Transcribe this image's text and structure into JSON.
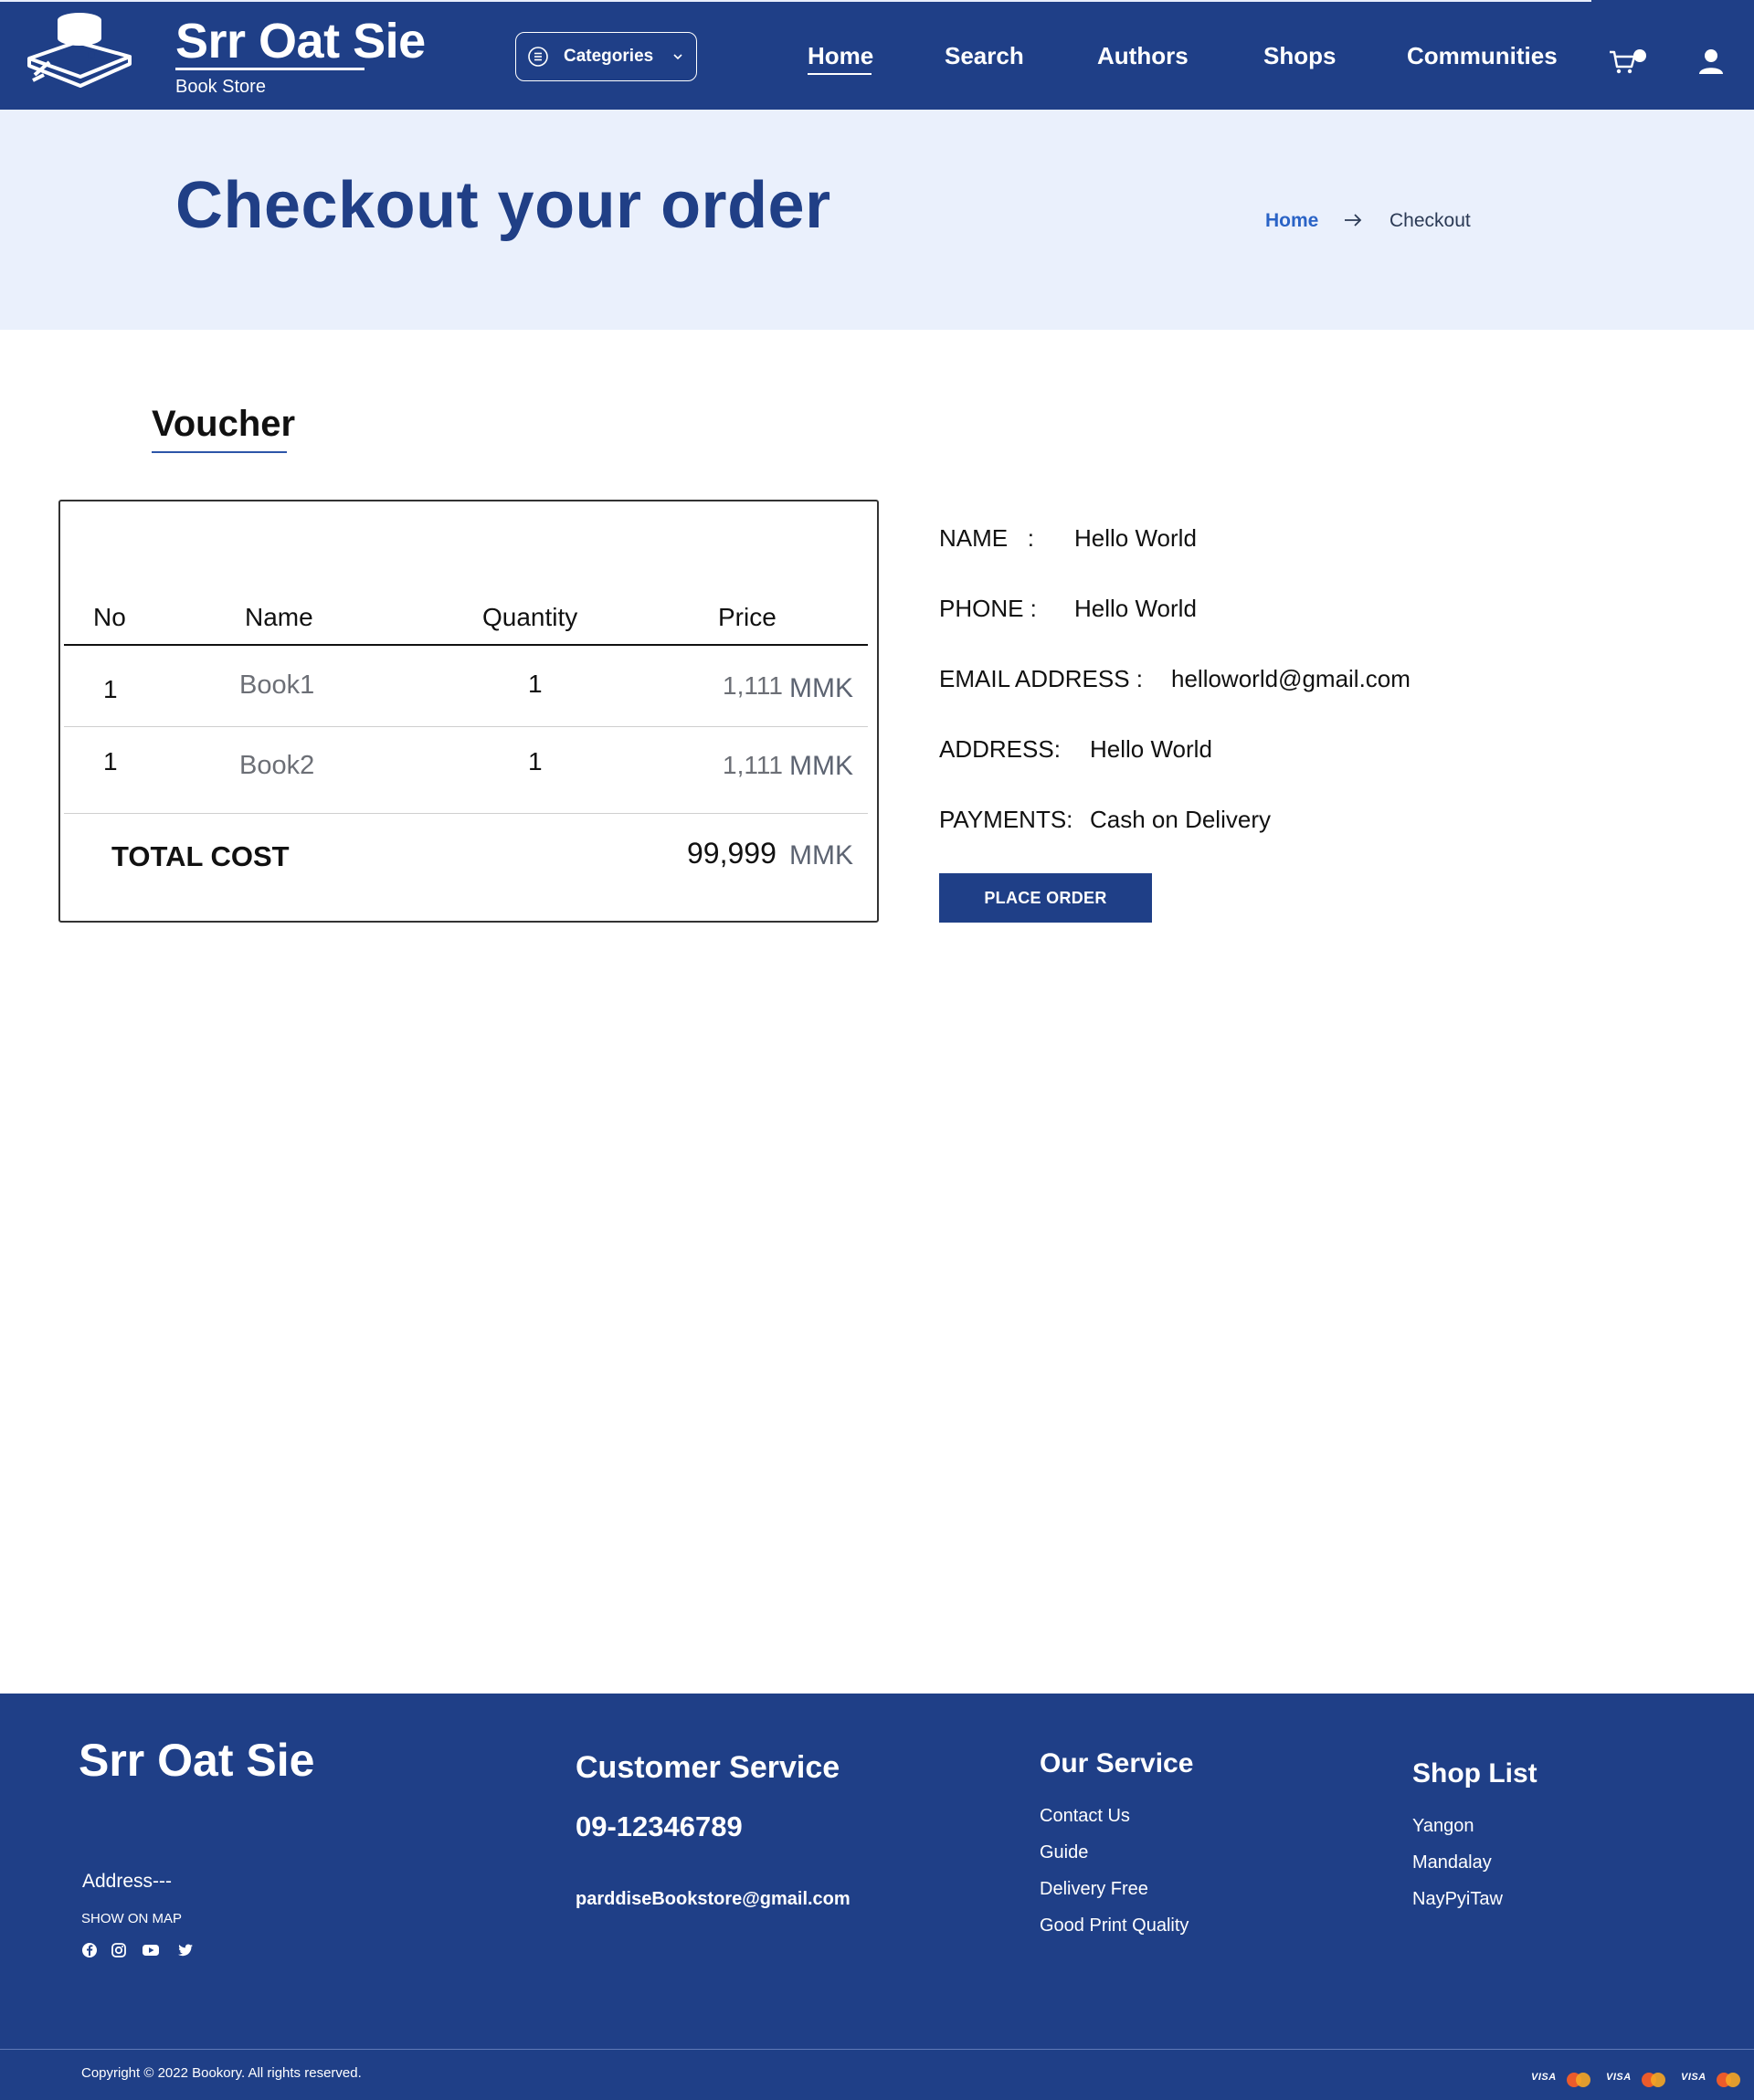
{
  "header": {
    "brand_name": "Srr Oat Sie",
    "brand_subtitle": "Book Store",
    "categories_label": "Categories",
    "nav": [
      "Home",
      "Search",
      "Authors",
      "Shops",
      "Communities"
    ],
    "icons": [
      "books-logo-icon",
      "list-icon",
      "chevron-down-icon",
      "cart-icon",
      "user-icon"
    ]
  },
  "banner": {
    "title": "Checkout your order",
    "breadcrumb_home": "Home",
    "breadcrumb_current": "Checkout"
  },
  "voucher": {
    "title": "Voucher",
    "columns": [
      "No",
      "Name",
      "Quantity",
      "Price"
    ],
    "rows": [
      {
        "no": "1",
        "name": "Book1",
        "quantity": "1",
        "price": "1,111",
        "currency": "MMK"
      },
      {
        "no": "1",
        "name": "Book2",
        "quantity": "1",
        "price": "1,111",
        "currency": "MMK"
      }
    ],
    "total_label": "TOTAL COST",
    "total_value": "99,999",
    "total_currency": "MMK"
  },
  "customer": {
    "name_label": "NAME   :",
    "name_value": "Hello World",
    "phone_label": "PHONE :",
    "phone_value": "Hello World",
    "email_label": "EMAIL ADDRESS :",
    "email_value": "helloworld@gmail.com",
    "address_label": "ADDRESS:",
    "address_value": "Hello World",
    "payments_label": "PAYMENTS:",
    "payments_value": "Cash on Delivery",
    "place_order_label": "PLACE ORDER"
  },
  "footer": {
    "brand": "Srr Oat Sie",
    "address": "Address---",
    "show_on_map": "SHOW ON MAP",
    "social_icons": [
      "facebook-icon",
      "instagram-icon",
      "youtube-icon",
      "twitter-icon"
    ],
    "customer_service_title": "Customer Service",
    "phone": "09-12346789",
    "email": "parddiseBookstore@gmail.com",
    "our_service_title": "Our Service",
    "our_service_links": [
      "Contact Us",
      "Guide",
      "Delivery Free",
      "Good Print Quality"
    ],
    "shop_list_title": "Shop List",
    "shop_list_links": [
      "Yangon",
      "Mandalay",
      "NayPyiTaw"
    ],
    "copyright": "Copyright © 2022 Bookory. All rights reserved.",
    "payment_icons": [
      "visa-icon",
      "mastercard-icon",
      "visa-icon",
      "mastercard-icon",
      "visa-icon",
      "mastercard-icon"
    ],
    "visa_text": "VISA"
  },
  "colors": {
    "primary": "#1f3f87",
    "banner_bg": "#eaf0fc",
    "link_blue": "#2a63c6"
  }
}
